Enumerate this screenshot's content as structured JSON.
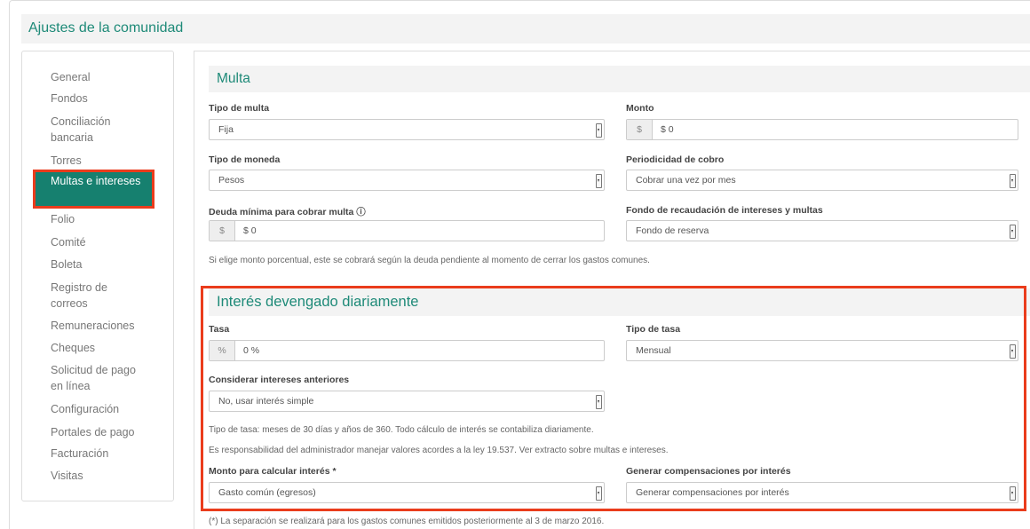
{
  "page": {
    "title": "Ajustes de la comunidad"
  },
  "sidebar": {
    "items": [
      {
        "label": "General"
      },
      {
        "label": "Fondos"
      },
      {
        "label": "Conciliación bancaria"
      },
      {
        "label": "Torres"
      },
      {
        "label": "Multas e intereses",
        "active": true
      },
      {
        "label": "Folio"
      },
      {
        "label": "Comité"
      },
      {
        "label": "Boleta"
      },
      {
        "label": "Registro de correos"
      },
      {
        "label": "Remuneraciones"
      },
      {
        "label": "Cheques"
      },
      {
        "label": "Solicitud de pago en línea"
      },
      {
        "label": "Configuración"
      },
      {
        "label": "Portales de pago"
      },
      {
        "label": "Facturación"
      },
      {
        "label": "Visitas"
      }
    ]
  },
  "multa": {
    "title": "Multa",
    "tipo_multa": {
      "label": "Tipo de multa",
      "value": "Fija"
    },
    "monto": {
      "label": "Monto",
      "addon": "$",
      "value": "$ 0"
    },
    "tipo_moneda": {
      "label": "Tipo de moneda",
      "value": "Pesos"
    },
    "periodicidad": {
      "label": "Periodicidad de cobro",
      "value": "Cobrar una vez por mes"
    },
    "deuda_minima": {
      "label": "Deuda mínima para cobrar multa ⓘ",
      "addon": "$",
      "value": "$ 0"
    },
    "fondo": {
      "label": "Fondo de recaudación de intereses y multas",
      "value": "Fondo de reserva"
    },
    "note": "Si elige monto porcentual, este se cobrará según la deuda pendiente al momento de cerrar los gastos comunes."
  },
  "interes": {
    "title": "Interés devengado diariamente",
    "tasa": {
      "label": "Tasa",
      "addon": "%",
      "value": "0 %"
    },
    "tipo_tasa": {
      "label": "Tipo de tasa",
      "value": "Mensual"
    },
    "considerar": {
      "label": "Considerar intereses anteriores",
      "value": "No, usar interés simple"
    },
    "note1": "Tipo de tasa: meses de 30 días y años de 360. Todo cálculo de interés se contabiliza diariamente.",
    "note2": "Es responsabilidad del administrador manejar valores acordes a la ley 19.537. Ver extracto sobre multas e intereses.",
    "monto_calc": {
      "label": "Monto para calcular interés *",
      "value": "Gasto común (egresos)"
    },
    "generar": {
      "label": "Generar compensaciones por interés",
      "value": "Generar compensaciones por interés"
    }
  },
  "footer_note": "(*) La separación se realizará para los gastos comunes emitidos posteriormente al 3 de marzo 2016.",
  "colors": {
    "accent": "#16806f",
    "highlight": "#ea3c1c"
  }
}
